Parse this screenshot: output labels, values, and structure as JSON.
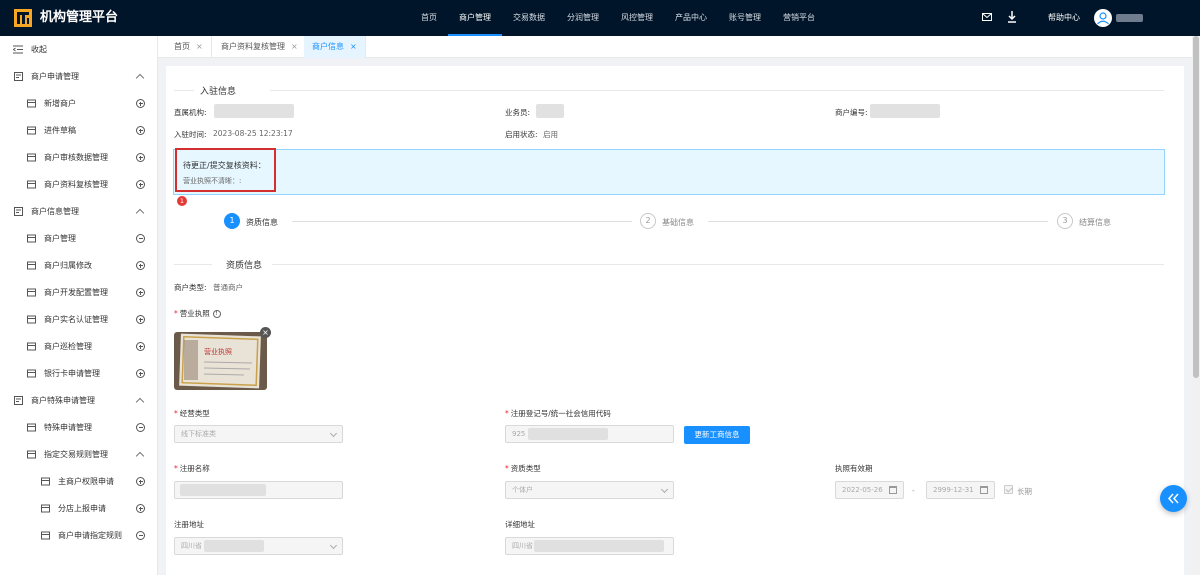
{
  "app": {
    "brand": "机构管理平台",
    "help": "帮助中心"
  },
  "topnav": [
    "首页",
    "商户管理",
    "交易数据",
    "分润管理",
    "风控管理",
    "产品中心",
    "账号管理",
    "营销平台"
  ],
  "topnav_active": 1,
  "sidebar": {
    "collapse": "收起",
    "items": [
      {
        "label": "商户申请管理",
        "level": 0,
        "end": "chevron"
      },
      {
        "label": "新增商户",
        "level": 1,
        "end": "plus"
      },
      {
        "label": "进件草稿",
        "level": 1,
        "end": "plus"
      },
      {
        "label": "商户审核数据管理",
        "level": 1,
        "end": "plus"
      },
      {
        "label": "商户资料复核管理",
        "level": 1,
        "end": "plus"
      },
      {
        "label": "商户信息管理",
        "level": 0,
        "end": "chevron"
      },
      {
        "label": "商户管理",
        "level": 1,
        "end": "minus"
      },
      {
        "label": "商户归属修改",
        "level": 1,
        "end": "plus"
      },
      {
        "label": "商户开发配置管理",
        "level": 1,
        "end": "plus"
      },
      {
        "label": "商户实名认证管理",
        "level": 1,
        "end": "plus"
      },
      {
        "label": "商户巡检管理",
        "level": 1,
        "end": "plus"
      },
      {
        "label": "银行卡申请管理",
        "level": 1,
        "end": "plus"
      },
      {
        "label": "商户特殊申请管理",
        "level": 0,
        "end": "chevron"
      },
      {
        "label": "特殊申请管理",
        "level": 1,
        "end": "minus"
      },
      {
        "label": "指定交易规则管理",
        "level": 1,
        "end": "chevron"
      },
      {
        "label": "主商户权限申请",
        "level": 2,
        "end": "plus"
      },
      {
        "label": "分店上报申请",
        "level": 2,
        "end": "plus"
      },
      {
        "label": "商户申请指定规则",
        "level": 2,
        "end": "minus"
      }
    ]
  },
  "tabs": [
    {
      "label": "首页",
      "close": "×"
    },
    {
      "label": "商户资料复核管理",
      "close": "×"
    },
    {
      "label": "商户信息",
      "close": "×"
    }
  ],
  "entry": {
    "section_title": "入驻信息",
    "direct_org_label": "直属机构:",
    "salesman_label": "业务员:",
    "merchant_no_label": "商户编号:",
    "entry_time_label": "入驻时间:",
    "entry_time_value": "2023-08-25 12:23:17",
    "status_label": "启用状态:",
    "status_value": "启用"
  },
  "notice": {
    "title": "待更正/提交复核资料：",
    "detail": "营业执照不清晰：:",
    "badge": "1"
  },
  "steps": [
    {
      "num": "1",
      "label": "资质信息"
    },
    {
      "num": "2",
      "label": "基础信息"
    },
    {
      "num": "3",
      "label": "结算信息"
    }
  ],
  "qualification": {
    "section_title": "资质信息",
    "merchant_type_label": "商户类型:",
    "merchant_type_value": "普通商户",
    "license_label": "营业执照",
    "license_img_text": "营业执照",
    "business_type_label": "经营类型",
    "business_type_value": "线下标准类",
    "reg_no_label": "注册登记号/统一社会信用代码",
    "reg_no_value": "925",
    "update_btn": "更新工商信息",
    "reg_name_label": "注册名称",
    "qual_type_label": "资质类型",
    "qual_type_value": "个体户",
    "validity_label": "执照有效期",
    "validity_start": "2022-05-26",
    "validity_sep": "-",
    "validity_end": "2999-12-31",
    "long_term_label": "长期",
    "reg_addr_label": "注册地址",
    "reg_addr_value": "四川省",
    "detail_addr_label": "详细地址",
    "detail_addr_value": "四川省"
  },
  "colors": {
    "nav_bg": "#001529",
    "primary": "#1890ff",
    "notice_bg": "#e6f7ff",
    "alert": "#d32f2f"
  }
}
